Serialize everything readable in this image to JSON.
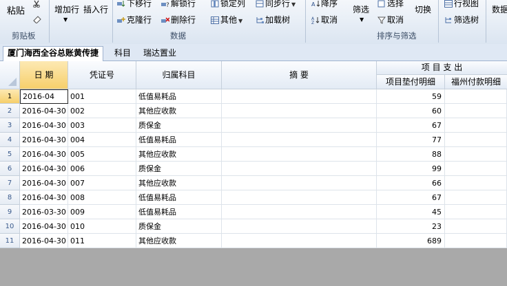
{
  "ribbon": {
    "paste": "粘贴",
    "clipboard_group": "剪贴板",
    "add_row": "增加行",
    "insert_row": "插入行",
    "move_down": "下移行",
    "clone_row": "克隆行",
    "unlock_row": "解锁行",
    "delete_row": "删除行",
    "lock_col": "锁定列",
    "sync_row": "同步行",
    "other": "其他",
    "load_tree": "加载树",
    "data_group": "数据",
    "desc_sort": "降序",
    "cancel_sort": "取消",
    "filter": "筛选",
    "select": "选择",
    "cancel_select": "取消",
    "toggle": "切换",
    "sort_filter_group": "排序与筛选",
    "row_view": "行视图",
    "filter_tree": "筛选树",
    "data_right": "数据"
  },
  "tabs": [
    "厦门海西全谷总账黄传捷",
    "科目",
    "瑞达置业"
  ],
  "columns": {
    "date": "日  期",
    "voucher": "凭证号",
    "subject": "归属科目",
    "summary": "摘        要",
    "expense_group": "项 目 支 出",
    "advance_detail": "项目垫付明细",
    "fuzhou_detail": "福州付款明细"
  },
  "rows": [
    {
      "n": "1",
      "date": "2016-04",
      "voucher": "001",
      "subject": "低值易耗品",
      "amount": "59"
    },
    {
      "n": "2",
      "date": "2016-04-30",
      "voucher": "002",
      "subject": "其他应收款",
      "amount": "60"
    },
    {
      "n": "3",
      "date": "2016-04-30",
      "voucher": "003",
      "subject": "质保金",
      "amount": "67"
    },
    {
      "n": "4",
      "date": "2016-04-30",
      "voucher": "004",
      "subject": "低值易耗品",
      "amount": "77"
    },
    {
      "n": "5",
      "date": "2016-04-30",
      "voucher": "005",
      "subject": "其他应收款",
      "amount": "88"
    },
    {
      "n": "6",
      "date": "2016-04-30",
      "voucher": "006",
      "subject": "质保金",
      "amount": "99"
    },
    {
      "n": "7",
      "date": "2016-04-30",
      "voucher": "007",
      "subject": "其他应收款",
      "amount": "66"
    },
    {
      "n": "8",
      "date": "2016-04-30",
      "voucher": "008",
      "subject": "低值易耗品",
      "amount": "67"
    },
    {
      "n": "9",
      "date": "2016-03-30",
      "voucher": "009",
      "subject": "低值易耗品",
      "amount": "45"
    },
    {
      "n": "10",
      "date": "2016-04-30",
      "voucher": "010",
      "subject": "质保金",
      "amount": "23"
    },
    {
      "n": "11",
      "date": "2016-04-30",
      "voucher": "011",
      "subject": "其他应收款",
      "amount": "689"
    }
  ]
}
